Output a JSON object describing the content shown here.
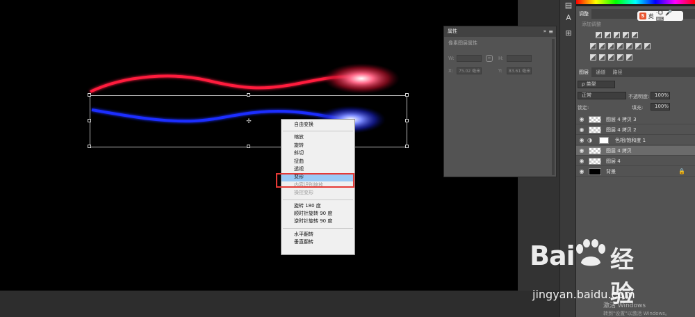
{
  "context_menu": {
    "items": [
      {
        "label": "自由变换",
        "state": "normal"
      },
      {
        "sep": true
      },
      {
        "label": "缩放",
        "state": "normal"
      },
      {
        "label": "旋转",
        "state": "normal"
      },
      {
        "label": "斜切",
        "state": "normal"
      },
      {
        "label": "扭曲",
        "state": "normal"
      },
      {
        "label": "透视",
        "state": "normal"
      },
      {
        "label": "变形",
        "state": "active"
      },
      {
        "label": "内容识别缩放",
        "state": "disabled"
      },
      {
        "label": "操控变形",
        "state": "disabled"
      },
      {
        "sep": true
      },
      {
        "label": "旋转 180 度",
        "state": "normal"
      },
      {
        "label": "顺时针旋转 90 度",
        "state": "normal"
      },
      {
        "label": "逆时针旋转 90 度",
        "state": "normal"
      },
      {
        "sep": true
      },
      {
        "label": "水平翻转",
        "state": "normal"
      },
      {
        "label": "垂直翻转",
        "state": "normal"
      }
    ]
  },
  "properties_panel": {
    "title": "属性",
    "collapse": "»",
    "close": "≡",
    "subtitle": "像素图层属性",
    "w_label": "W:",
    "h_label": "H:",
    "x_label": "X:",
    "y_label": "Y:",
    "x_value": "75.02 毫米",
    "y_value": "83.61 毫米",
    "link_icon": "link-icon"
  },
  "adjustments": {
    "tab": "调整",
    "subtitle": "添加调整"
  },
  "ime": {
    "badge": "S",
    "lang": "英",
    "icons": "·☺ 🎤 ⌨"
  },
  "layers": {
    "tabs": [
      "图层",
      "通道",
      "路径"
    ],
    "filter_label": "ρ 类型",
    "blend_mode": "正常",
    "opacity_label": "不透明度:",
    "opacity_value": "100%",
    "lock_label": "锁定:",
    "fill_label": "填充:",
    "fill_value": "100%",
    "items": [
      {
        "name": "图层 4 拷贝 3",
        "thumb": "transparent",
        "selected": false
      },
      {
        "name": "图层 4 拷贝 2",
        "thumb": "transparent",
        "selected": false
      },
      {
        "name": "色相/饱和度 1",
        "thumb": "adjustment",
        "selected": false
      },
      {
        "name": "图层 4 拷贝",
        "thumb": "transparent",
        "selected": true
      },
      {
        "name": "图层 4",
        "thumb": "transparent",
        "selected": false
      },
      {
        "name": "背景",
        "thumb": "black",
        "selected": false,
        "locked": true
      }
    ]
  },
  "watermark": {
    "logo_text": "Bai",
    "logo_cn": "经验",
    "url": "jingyan.baidu.com"
  },
  "activation": {
    "title": "激活 Windows",
    "subtitle": "转到\"设置\"以激活 Windows。"
  },
  "colors": {
    "red_ribbon": "#ff1a3c",
    "blue_ribbon": "#1a2dff",
    "menu_highlight": "#99c9f5",
    "callout_red": "#e53935"
  }
}
